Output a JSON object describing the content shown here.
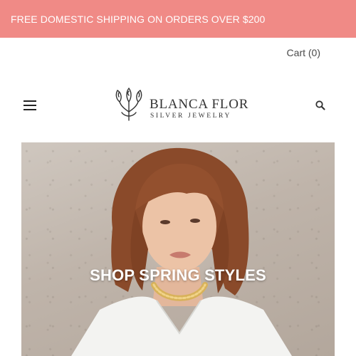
{
  "announcement": {
    "text": "FREE DOMESTIC SHIPPING ON ORDERS OVER $200",
    "background": "#f08a86"
  },
  "header": {
    "cart_label": "Cart (0)",
    "menu_icon": "hamburger-menu-icon",
    "search_icon": "magnifier-icon",
    "logo": {
      "name": "BLANCA FLOR",
      "tagline": "SILVER JEWELRY"
    }
  },
  "hero": {
    "cta": "SHOP SPRING STYLES",
    "image": "model-with-gold-chain-necklace"
  }
}
